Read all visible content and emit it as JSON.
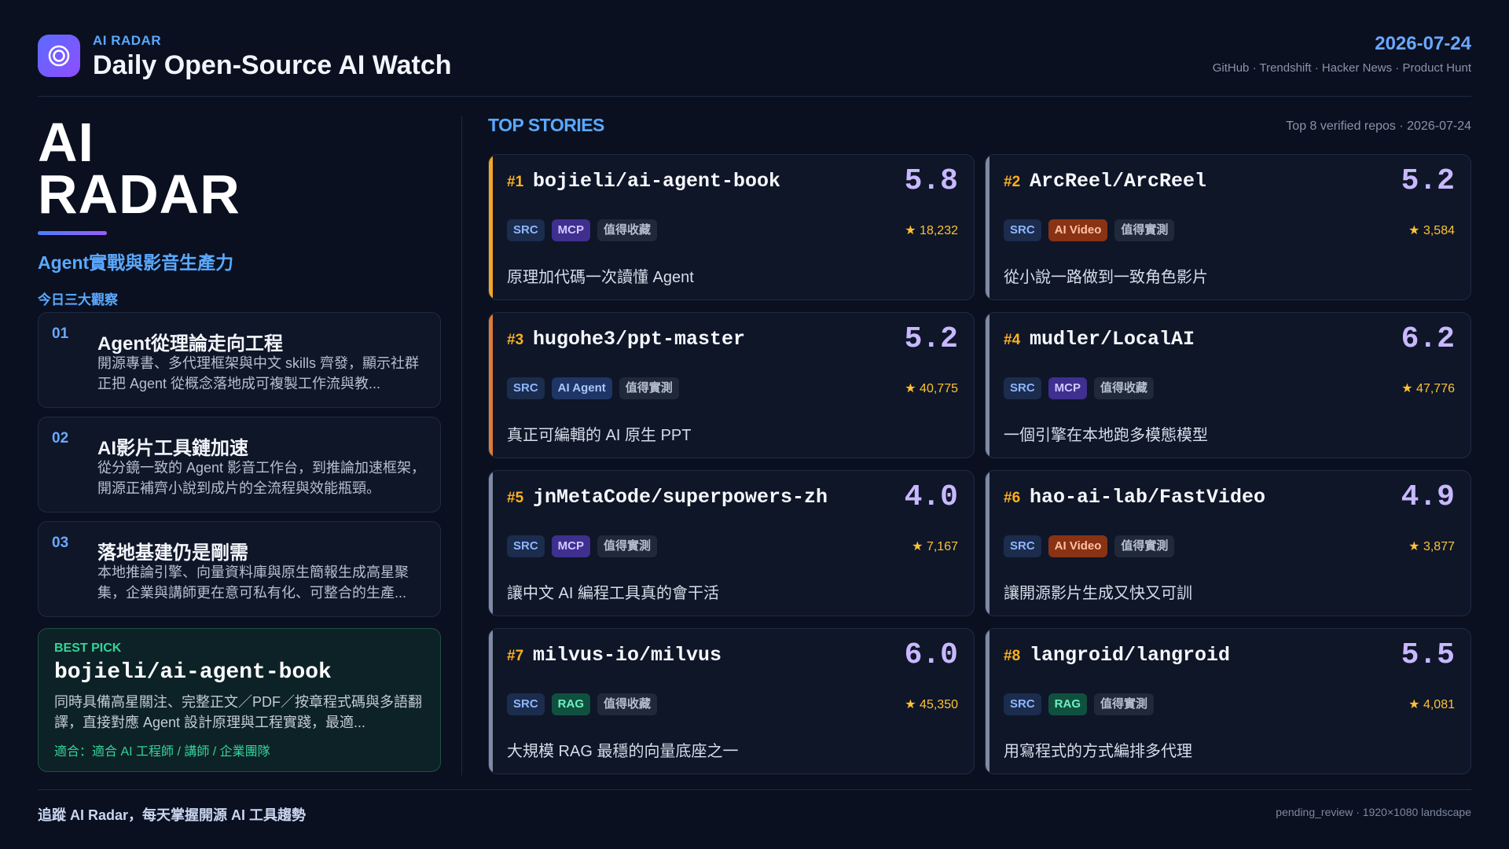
{
  "header": {
    "brand": "AI RADAR",
    "title": "Daily Open-Source AI Watch",
    "date": "2026-07-24",
    "sources": "GitHub · Trendshift · Hacker News · Product Hunt",
    "logo_icon": "target-icon"
  },
  "left": {
    "big_title_line1": "AI",
    "big_title_line2": "RADAR",
    "subtitle": "Agent實戰與影音生產力",
    "insights_label": "今日三大觀察",
    "insights": [
      {
        "num": "01",
        "title": "Agent從理論走向工程",
        "desc": "開源專書、多代理框架與中文 skills 齊發，顯示社群正把 Agent 從概念落地成可複製工作流與教..."
      },
      {
        "num": "02",
        "title": "AI影片工具鏈加速",
        "desc": "從分鏡一致的 Agent 影音工作台，到推論加速框架，開源正補齊小說到成片的全流程與效能瓶頸。"
      },
      {
        "num": "03",
        "title": "落地基建仍是剛需",
        "desc": "本地推論引擎、向量資料庫與原生簡報生成高星聚集，企業與講師更在意可私有化、可整合的生產..."
      }
    ],
    "best_pick": {
      "label": "BEST PICK",
      "repo": "bojieli/ai-agent-book",
      "desc": "同時具備高星關注、完整正文／PDF／按章程式碼與多語翻譯，直接對應 Agent 設計原理與工程實踐，最適...",
      "fit": "適合：適合 AI 工程師 / 講師 / 企業團隊"
    }
  },
  "stories": {
    "title": "TOP STORIES",
    "meta": "Top 8 verified repos · 2026-07-24",
    "colors": {
      "gold": "#f5a623",
      "orange": "#e07b34",
      "slate": "#7f8aa3"
    },
    "items": [
      {
        "rank": "#1",
        "repo": "bojieli/ai-agent-book",
        "score": "5.8",
        "tags": [
          "SRC",
          "MCP",
          "值得收藏"
        ],
        "stars": "★ 18,232",
        "desc": "原理加代碼一次讀懂 Agent"
      },
      {
        "rank": "#2",
        "repo": "ArcReel/ArcReel",
        "score": "5.2",
        "tags": [
          "SRC",
          "AI Video",
          "值得實測"
        ],
        "stars": "★ 3,584",
        "desc": "從小說一路做到一致角色影片"
      },
      {
        "rank": "#3",
        "repo": "hugohe3/ppt-master",
        "score": "5.2",
        "tags": [
          "SRC",
          "AI Agent",
          "值得實測"
        ],
        "stars": "★ 40,775",
        "desc": "真正可編輯的 AI 原生 PPT"
      },
      {
        "rank": "#4",
        "repo": "mudler/LocalAI",
        "score": "6.2",
        "tags": [
          "SRC",
          "MCP",
          "值得收藏"
        ],
        "stars": "★ 47,776",
        "desc": "一個引擎在本地跑多模態模型"
      },
      {
        "rank": "#5",
        "repo": "jnMetaCode/superpowers-zh",
        "score": "4.0",
        "tags": [
          "SRC",
          "MCP",
          "值得實測"
        ],
        "stars": "★ 7,167",
        "desc": "讓中文 AI 編程工具真的會干活"
      },
      {
        "rank": "#6",
        "repo": "hao-ai-lab/FastVideo",
        "score": "4.9",
        "tags": [
          "SRC",
          "AI Video",
          "值得實測"
        ],
        "stars": "★ 3,877",
        "desc": "讓開源影片生成又快又可訓"
      },
      {
        "rank": "#7",
        "repo": "milvus-io/milvus",
        "score": "6.0",
        "tags": [
          "SRC",
          "RAG",
          "值得收藏"
        ],
        "stars": "★ 45,350",
        "desc": "大規模 RAG 最穩的向量底座之一"
      },
      {
        "rank": "#8",
        "repo": "langroid/langroid",
        "score": "5.5",
        "tags": [
          "SRC",
          "RAG",
          "值得實測"
        ],
        "stars": "★ 4,081",
        "desc": "用寫程式的方式編排多代理"
      }
    ]
  },
  "footer": {
    "left": "追蹤 AI Radar，每天掌握開源 AI 工具趨勢",
    "right": "pending_review · 1920×1080 landscape"
  }
}
